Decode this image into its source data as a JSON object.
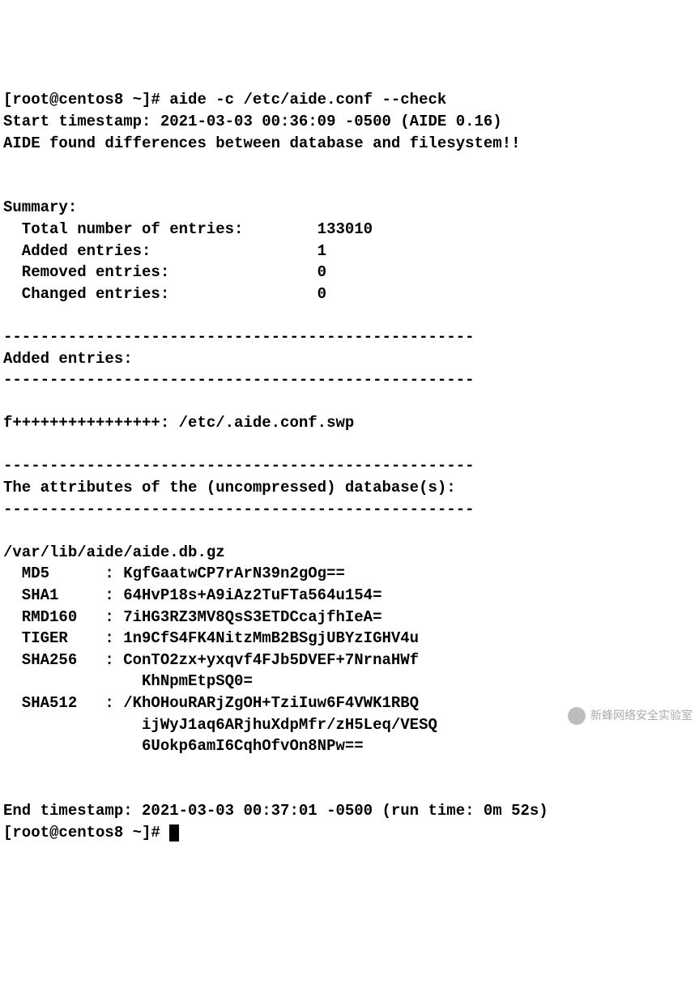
{
  "prompt1": "[root@centos8 ~]# ",
  "command": "aide -c /etc/aide.conf --check",
  "start_ts_line": "Start timestamp: 2021-03-03 00:36:09 -0500 (AIDE 0.16)",
  "found_line": "AIDE found differences between database and filesystem!!",
  "summary_heading": "Summary:",
  "summary_rows": [
    {
      "label": "  Total number of entries:",
      "value": "133010"
    },
    {
      "label": "  Added entries:",
      "value": "1"
    },
    {
      "label": "  Removed entries:",
      "value": "0"
    },
    {
      "label": "  Changed entries:",
      "value": "0"
    }
  ],
  "sep": "---------------------------------------------------",
  "added_heading": "Added entries:",
  "added_entry": "f++++++++++++++++: /etc/.aide.conf.swp",
  "attrs_heading": "The attributes of the (uncompressed) database(s):",
  "db_path": "/var/lib/aide/aide.db.gz",
  "hashes": [
    {
      "algo": "MD5",
      "lines": [
        "KgfGaatwCP7rArN39n2gOg=="
      ]
    },
    {
      "algo": "SHA1",
      "lines": [
        "64HvP18s+A9iAz2TuFTa564u154="
      ]
    },
    {
      "algo": "RMD160",
      "lines": [
        "7iHG3RZ3MV8QsS3ETDCcajfhIeA="
      ]
    },
    {
      "algo": "TIGER",
      "lines": [
        "1n9CfS4FK4NitzMmB2BSgjUBYzIGHV4u"
      ]
    },
    {
      "algo": "SHA256",
      "lines": [
        "ConTO2zx+yxqvf4FJb5DVEF+7NrnaHWf",
        "KhNpmEtpSQ0="
      ]
    },
    {
      "algo": "SHA512",
      "lines": [
        "/KhOHouRARjZgOH+TziIuw6F4VWK1RBQ",
        "ijWyJ1aq6ARjhuXdpMfr/zH5Leq/VESQ",
        "6Uokp6amI6CqhOfvOn8NPw=="
      ]
    }
  ],
  "end_ts_line": "End timestamp: 2021-03-03 00:37:01 -0500 (run time: 0m 52s)",
  "prompt2": "[root@centos8 ~]# ",
  "watermark": "新蜂网络安全实验室"
}
